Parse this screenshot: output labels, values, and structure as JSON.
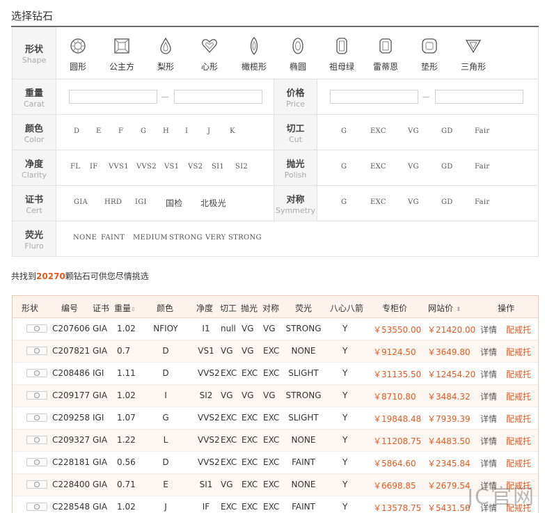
{
  "page_title": "选择钻石",
  "filters": {
    "shape": {
      "zh": "形状",
      "en": "Shape",
      "items": [
        {
          "label": "圆形",
          "icon": "round-diamond-icon"
        },
        {
          "label": "公主方",
          "icon": "princess-diamond-icon"
        },
        {
          "label": "梨形",
          "icon": "pear-diamond-icon"
        },
        {
          "label": "心形",
          "icon": "heart-diamond-icon"
        },
        {
          "label": "橄榄形",
          "icon": "marquise-diamond-icon"
        },
        {
          "label": "椭圆",
          "icon": "oval-diamond-icon"
        },
        {
          "label": "祖母绿",
          "icon": "emerald-diamond-icon"
        },
        {
          "label": "雷蒂恩",
          "icon": "radiant-diamond-icon"
        },
        {
          "label": "垫形",
          "icon": "cushion-diamond-icon"
        },
        {
          "label": "三角形",
          "icon": "triangle-diamond-icon"
        }
      ]
    },
    "carat": {
      "zh": "重量",
      "en": "Carat",
      "min": "",
      "max": ""
    },
    "price": {
      "zh": "价格",
      "en": "Price",
      "min": "",
      "max": ""
    },
    "color": {
      "zh": "颜色",
      "en": "Color",
      "options": [
        "D",
        "E",
        "F",
        "G",
        "H",
        "I",
        "J",
        "K"
      ]
    },
    "cut": {
      "zh": "切工",
      "en": "Cut",
      "options": [
        "G",
        "EXC",
        "VG",
        "GD",
        "Fair"
      ]
    },
    "clarity": {
      "zh": "净度",
      "en": "Clarity",
      "options": [
        "FL",
        "IF",
        "VVS1",
        "VVS2",
        "VS1",
        "VS2",
        "SI1",
        "SI2"
      ]
    },
    "polish": {
      "zh": "抛光",
      "en": "Polish",
      "options": [
        "G",
        "EXC",
        "VG",
        "GD",
        "Fair"
      ]
    },
    "cert": {
      "zh": "证书",
      "en": "Cert",
      "options": [
        "GIA",
        "HRD",
        "IGI",
        "国检",
        "北极光"
      ]
    },
    "symmetry": {
      "zh": "对称",
      "en": "Symmetry",
      "options": [
        "G",
        "EXC",
        "VG",
        "GD",
        "Fair"
      ]
    },
    "fluro": {
      "zh": "荧光",
      "en": "Fluro",
      "options": [
        "NONE",
        "FAINT",
        "MEDIUM",
        "STRONG",
        "VERY STRONG"
      ]
    }
  },
  "result": {
    "prefix": "共找到",
    "count": "20270",
    "suffix": "颗钻石可供您尽情挑选"
  },
  "table": {
    "headers": [
      "形状",
      "编号",
      "证书",
      "重量",
      "颜色",
      "净度",
      "切工",
      "抛光",
      "对称",
      "荧光",
      "八心八箭",
      "专柜价",
      "网站价",
      "操作"
    ],
    "sort_icon": "sort-arrows-icon",
    "rows": [
      {
        "id": "C207606",
        "cert": "GIA",
        "carat": "1.02",
        "color": "NFIOY",
        "clarity": "I1",
        "cut": "null",
        "polish": "VG",
        "sym": "VG",
        "fluro": "STRONG",
        "hc": "Y",
        "counter": "￥53550.00",
        "web": "￥21420.00",
        "detail": "详情",
        "setting": "配戒托"
      },
      {
        "id": "C207821",
        "cert": "GIA",
        "carat": "0.7",
        "color": "D",
        "clarity": "VS1",
        "cut": "VG",
        "polish": "VG",
        "sym": "EXC",
        "fluro": "NONE",
        "hc": "Y",
        "counter": "￥9124.50",
        "web": "￥3649.80",
        "detail": "详情",
        "setting": "配戒托"
      },
      {
        "id": "C208486",
        "cert": "IGI",
        "carat": "1.11",
        "color": "D",
        "clarity": "VVS2",
        "cut": "EXC",
        "polish": "EXC",
        "sym": "EXC",
        "fluro": "SLIGHT",
        "hc": "Y",
        "counter": "￥31135.50",
        "web": "￥12454.20",
        "detail": "详情",
        "setting": "配戒托"
      },
      {
        "id": "C209177",
        "cert": "GIA",
        "carat": "1.02",
        "color": "I",
        "clarity": "SI2",
        "cut": "VG",
        "polish": "VG",
        "sym": "VG",
        "fluro": "STRONG",
        "hc": "Y",
        "counter": "￥8710.80",
        "web": "￥3484.32",
        "detail": "详情",
        "setting": "配戒托"
      },
      {
        "id": "C209258",
        "cert": "IGI",
        "carat": "1.07",
        "color": "G",
        "clarity": "VVS2",
        "cut": "EXC",
        "polish": "EXC",
        "sym": "EXC",
        "fluro": "SLIGHT",
        "hc": "Y",
        "counter": "￥19848.48",
        "web": "￥7939.39",
        "detail": "详情",
        "setting": "配戒托"
      },
      {
        "id": "C209327",
        "cert": "GIA",
        "carat": "1.22",
        "color": "L",
        "clarity": "VVS2",
        "cut": "EXC",
        "polish": "EXC",
        "sym": "EXC",
        "fluro": "NONE",
        "hc": "Y",
        "counter": "￥11208.75",
        "web": "￥4483.50",
        "detail": "详情",
        "setting": "配戒托"
      },
      {
        "id": "C228181",
        "cert": "GIA",
        "carat": "0.56",
        "color": "D",
        "clarity": "VVS2",
        "cut": "EXC",
        "polish": "EXC",
        "sym": "EXC",
        "fluro": "FAINT",
        "hc": "Y",
        "counter": "￥5864.60",
        "web": "￥2345.84",
        "detail": "详情",
        "setting": "配戒托"
      },
      {
        "id": "C228400",
        "cert": "GIA",
        "carat": "0.71",
        "color": "E",
        "clarity": "SI1",
        "cut": "VG",
        "polish": "EXC",
        "sym": "EXC",
        "fluro": "NONE",
        "hc": "Y",
        "counter": "￥6698.85",
        "web": "￥2679.54",
        "detail": "详情",
        "setting": "配戒托"
      },
      {
        "id": "C228548",
        "cert": "GIA",
        "carat": "1.02",
        "color": "J",
        "clarity": "IF",
        "cut": "EXC",
        "polish": "EXC",
        "sym": "EXC",
        "fluro": "FAINT",
        "hc": "Y",
        "counter": "￥13578.75",
        "web": "￥5431.50",
        "detail": "详情",
        "setting": "配戒托"
      }
    ]
  },
  "watermark": "JC官网",
  "colors": {
    "accent": "#e4591f",
    "header_bg": "#fdf3ec",
    "label_bg": "#f5f5f5"
  }
}
